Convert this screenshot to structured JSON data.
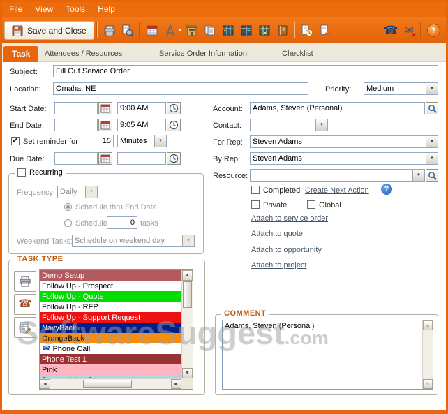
{
  "colors": {
    "accent": "#E8650C",
    "tab_bg": "#EDE9DD"
  },
  "menu": {
    "items": [
      "File",
      "View",
      "Tools",
      "Help"
    ]
  },
  "toolbar": {
    "save_button": "Save and Close",
    "icon_names": [
      "save-icon",
      "print-icon",
      "print-preview-icon",
      "calendar-icon",
      "compass-icon",
      "compass-dropdown-caret",
      "building-icon",
      "documents-icon",
      "planner-grid-icon",
      "journal-grid-icon",
      "ledger-grid-icon",
      "notebook-icon",
      "clock-document-icon",
      "new-document-icon",
      "phone-icon",
      "mail-remove-icon",
      "help-icon"
    ]
  },
  "tabs": [
    {
      "label": "Task",
      "active": true
    },
    {
      "label": "Attendees / Resources",
      "active": false
    },
    {
      "label": "Service Order Information",
      "active": false
    },
    {
      "label": "Checklist",
      "active": false
    }
  ],
  "form": {
    "subject_label": "Subject:",
    "subject_value": "Fill Out Service Order",
    "location_label": "Location:",
    "location_value": "Omaha, NE",
    "priority_label": "Priority:",
    "priority_value": "Medium",
    "start_date_label": "Start Date:",
    "start_date_value": "",
    "start_time_value": "9:00 AM",
    "end_date_label": "End Date:",
    "end_date_value": "",
    "end_time_value": "9:05 AM",
    "reminder_label": "Set reminder for",
    "reminder_value": "15",
    "reminder_unit": "Minutes",
    "due_date_label": "Due Date:",
    "due_date_value": "",
    "due_time_value": "",
    "account_label": "Account:",
    "account_value": "Adams, Steven  (Personal)",
    "contact_label": "Contact:",
    "contact_value": "",
    "contact_text_value": "",
    "for_rep_label": "For Rep:",
    "for_rep_value": "Steven Adams",
    "by_rep_label": "By Rep:",
    "by_rep_value": "Steven Adams",
    "resource_label": "Resource:",
    "resource_value": "",
    "completed_label": "Completed",
    "create_next_action": "Create Next Action",
    "private_label": "Private",
    "global_label": "Global",
    "attach_links": [
      "Attach to service order",
      "Attach to quote",
      "Attach to opportunity",
      "Attach to project"
    ]
  },
  "recurring": {
    "legend": "Recurring",
    "frequency_label": "Frequency:",
    "frequency_value": "Daily",
    "schedule_thru_label": "Schedule thru End Date",
    "schedule_label": "Schedule",
    "schedule_tasks_value": "0",
    "tasks_label": "tasks",
    "weekend_label": "Weekend Tasks:",
    "weekend_value": "Schedule on weekend day"
  },
  "task_type": {
    "title": "TASK TYPE",
    "items": [
      {
        "label": "Demo Setup",
        "bg": "#b25a5e",
        "fg": "#ffffff"
      },
      {
        "label": "Follow Up - Prospect",
        "bg": "#ffffff",
        "fg": "#000000"
      },
      {
        "label": "Follow Up - Quote",
        "bg": "#00dd00",
        "fg": "#ffffff"
      },
      {
        "label": "Follow Up - RFP",
        "bg": "#ffffff",
        "fg": "#000000"
      },
      {
        "label": "Follow Up - Support Request",
        "bg": "#ee1111",
        "fg": "#ffffff"
      },
      {
        "label": "NavyBack",
        "bg": "#001f8b",
        "fg": "#ffffff"
      },
      {
        "label": "OrangeBack",
        "bg": "#ff8c00",
        "fg": "#000000"
      },
      {
        "label": "Phone Call",
        "bg": "#ffffff",
        "fg": "#000000",
        "icon": "phone"
      },
      {
        "label": "Phone Test 1",
        "bg": "#993333",
        "fg": "#ffffff"
      },
      {
        "label": "Pink",
        "bg": "#ffb6c1",
        "fg": "#000000"
      },
      {
        "label": "Prospect Inquiry",
        "bg": "#a6d8f0",
        "fg": "#000000"
      }
    ]
  },
  "comment": {
    "title": "COMMENT",
    "value": "Adams, Steven  (Personal)"
  },
  "watermark": {
    "text": "SoftwareSuggest",
    "suffix": ".com"
  }
}
